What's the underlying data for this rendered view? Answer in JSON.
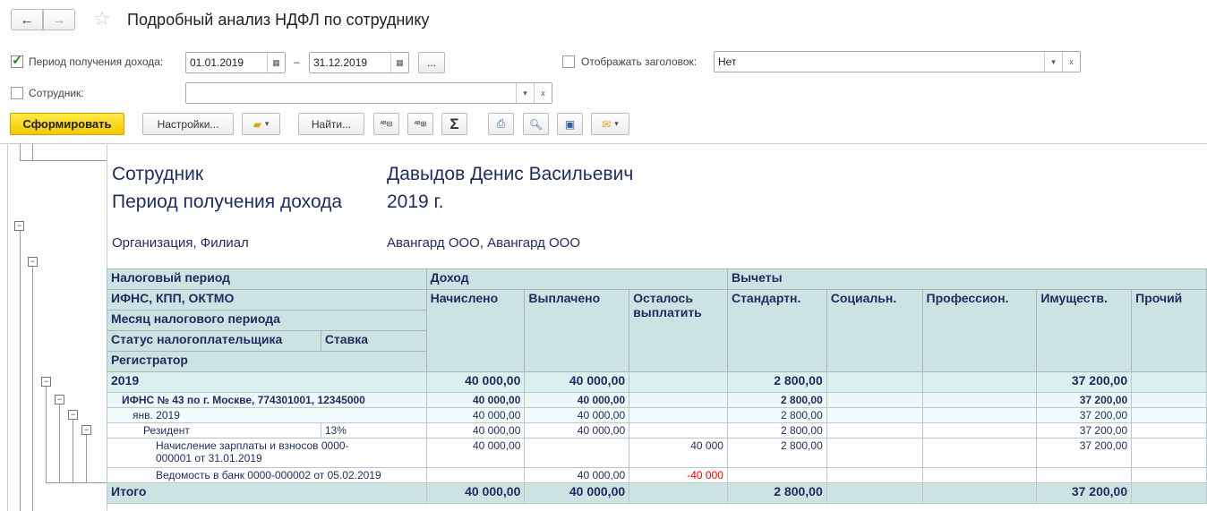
{
  "header": {
    "title": "Подробный анализ НДФЛ по сотруднику",
    "back": "←",
    "forward": "→"
  },
  "filters": {
    "period_label": "Период получения дохода:",
    "period_checked": true,
    "date_from": "01.01.2019",
    "dash": "–",
    "date_to": "31.12.2019",
    "more": "...",
    "show_title_label": "Отображать заголовок:",
    "show_title_value": "Нет",
    "employee_label": "Сотрудник:",
    "employee_value": ""
  },
  "toolbar": {
    "generate": "Сформировать",
    "settings": "Настройки...",
    "find": "Найти...",
    "sum": "Σ"
  },
  "report": {
    "employee_label": "Сотрудник",
    "employee_value": "Давыдов Денис Васильевич",
    "period_label": "Период получения дохода",
    "period_value": "2019 г.",
    "org_label": "Организация, Филиал",
    "org_value": "Авангард ООО, Авангард ООО",
    "headers": {
      "tax_period": "Налоговый период",
      "ifns": "ИФНС, КПП, ОКТМО",
      "month": "Месяц налогового периода",
      "status": "Статус налогоплательщика",
      "rate": "Ставка",
      "registrar": "Регистратор",
      "income": "Доход",
      "accrued": "Начислено",
      "paid": "Выплачено",
      "remaining": "Осталось выплатить",
      "deductions": "Вычеты",
      "standard": "Стандартн.",
      "social": "Социальн.",
      "professional": "Профессион.",
      "property": "Имуществ.",
      "other": "Прочий"
    },
    "rows": [
      {
        "name": "2019",
        "rate": "",
        "accrued": "40 000,00",
        "paid": "40 000,00",
        "remaining": "",
        "standard": "2 800,00",
        "social": "",
        "professional": "",
        "property": "37 200,00",
        "other": ""
      },
      {
        "name": "ИФНС № 43 по г. Москве, 774301001, 12345000",
        "rate": "",
        "accrued": "40 000,00",
        "paid": "40 000,00",
        "remaining": "",
        "standard": "2 800,00",
        "social": "",
        "professional": "",
        "property": "37 200,00",
        "other": ""
      },
      {
        "name": "янв. 2019",
        "rate": "",
        "accrued": "40 000,00",
        "paid": "40 000,00",
        "remaining": "",
        "standard": "2 800,00",
        "social": "",
        "professional": "",
        "property": "37 200,00",
        "other": ""
      },
      {
        "name": "Резидент",
        "rate": "13%",
        "accrued": "40 000,00",
        "paid": "40 000,00",
        "remaining": "",
        "standard": "2 800,00",
        "social": "",
        "professional": "",
        "property": "37 200,00",
        "other": ""
      },
      {
        "name": "Начисление зарплаты и взносов 0000-000001 от 31.01.2019",
        "rate": "",
        "accrued": "40 000,00",
        "paid": "",
        "remaining": "40 000",
        "standard": "2 800,00",
        "social": "",
        "professional": "",
        "property": "37 200,00",
        "other": ""
      },
      {
        "name": "Ведомость в банк 0000-000002 от 05.02.2019",
        "rate": "",
        "accrued": "",
        "paid": "40 000,00",
        "remaining": "-40 000",
        "standard": "",
        "social": "",
        "professional": "",
        "property": "",
        "other": ""
      }
    ],
    "total": {
      "name": "Итого",
      "accrued": "40 000,00",
      "paid": "40 000,00",
      "remaining": "",
      "standard": "2 800,00",
      "social": "",
      "professional": "",
      "property": "37 200,00",
      "other": ""
    }
  }
}
